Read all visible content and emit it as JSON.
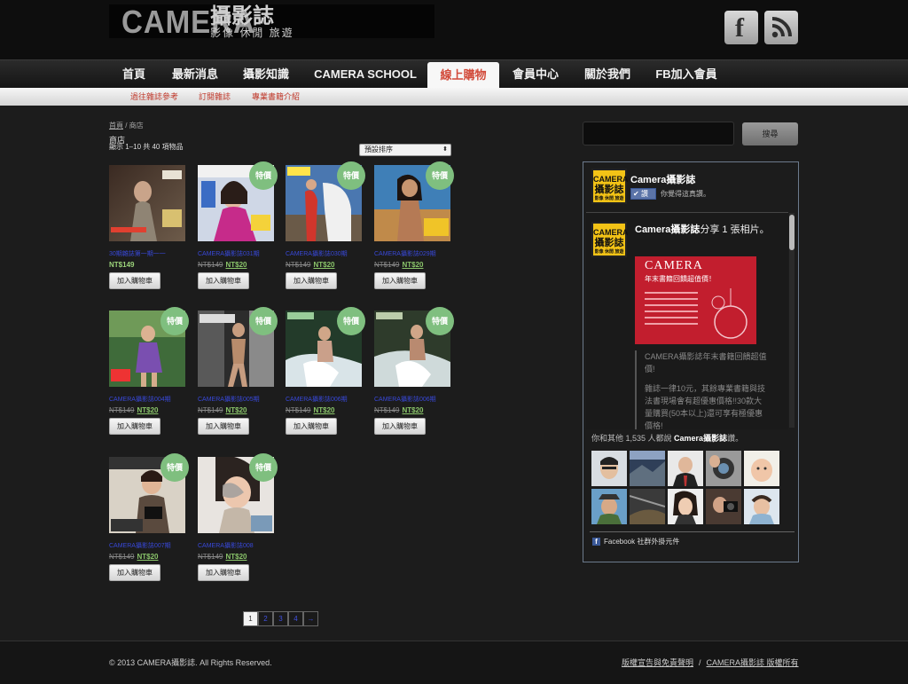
{
  "header": {
    "logo_latin": "CAMERA",
    "logo_cn": "攝影誌",
    "logo_tagline": "影像 休閒 旅遊",
    "facebook_glyph": "f"
  },
  "nav": {
    "items": [
      "首頁",
      "最新消息",
      "攝影知識",
      "CAMERA SCHOOL",
      "線上購物",
      "會員中心",
      "關於我們",
      "FB加入會員"
    ],
    "active_index": 4
  },
  "subnav": {
    "items": [
      "過往雜誌參考",
      "訂閱雜誌",
      "專業書籍介紹"
    ]
  },
  "breadcrumb": {
    "home": "首頁",
    "separator": " / ",
    "current": "商店"
  },
  "shop": {
    "title": "商店",
    "results": "顯示 1–10 共 40 項物品",
    "sort_label": "預設排序",
    "sort_arrow": "⬍",
    "sale_badge": "特價",
    "add_to_cart": "加入購物車"
  },
  "products": [
    {
      "name": "30期雜誌第一期一一",
      "old_price": "",
      "price": "NT$149",
      "sale": false
    },
    {
      "name": "CAMERA攝影誌031期",
      "old_price": "NT$149",
      "price": "NT$20",
      "sale": true
    },
    {
      "name": "CAMERA攝影誌030期",
      "old_price": "NT$149",
      "price": "NT$20",
      "sale": true
    },
    {
      "name": "CAMERA攝影誌029期",
      "old_price": "NT$149",
      "price": "NT$20",
      "sale": true
    },
    {
      "name": "CAMERA攝影誌004期",
      "old_price": "NT$149",
      "price": "NT$20",
      "sale": true
    },
    {
      "name": "CAMERA攝影誌005期",
      "old_price": "NT$149",
      "price": "NT$20",
      "sale": true
    },
    {
      "name": "CAMERA攝影誌006期",
      "old_price": "NT$149",
      "price": "NT$20",
      "sale": true
    },
    {
      "name": "CAMERA攝影誌006期",
      "old_price": "NT$149",
      "price": "NT$20",
      "sale": true
    },
    {
      "name": "CAMERA攝影誌007期",
      "old_price": "NT$149",
      "price": "NT$20",
      "sale": true
    },
    {
      "name": "CAMERA攝影誌008",
      "old_price": "NT$149",
      "price": "NT$20",
      "sale": true
    }
  ],
  "pagination": {
    "pages": [
      "1",
      "2",
      "3",
      "4",
      "→"
    ],
    "current": "1"
  },
  "search": {
    "button": "搜尋",
    "placeholder": ""
  },
  "facebook_box": {
    "page_name": "Camera攝影誌",
    "logo_line1": "CAMERA",
    "logo_line2": "攝影誌",
    "logo_line3": "影像 休閒 旅遊",
    "like_button": "讚",
    "like_text": "你覺得這真讚。",
    "post_author": "Camera攝影誌",
    "post_action": "分享 1 張相片。",
    "post_image_title": "CAMERA",
    "post_image_subtitle": "年末書籍回饋超值價！",
    "post_text_1": "CAMERA攝影誌年末書籍回饋超值價!",
    "post_text_2": "雜誌一律10元，其餘專業書籍與技法書現場會有超優惠價格!!30款大量購買(50本以上)還可享有極優惠價格!",
    "fans_count_text": "你和其他 1,535 人都說",
    "fans_page": "Camera攝影誌",
    "fans_suffix": "讚。",
    "plugin_label": "Facebook 社群外掛元件"
  },
  "footer": {
    "copyright": "© 2013 CAMERA攝影誌. All Rights Reserved.",
    "link_1": "版權宣告與免責聲明",
    "separator": "/",
    "link_2": "CAMERA攝影誌 版權所有"
  },
  "colors": {
    "accent_red": "#d24a3a",
    "sale_green": "#7fbf7f",
    "price_green": "#8ac56a",
    "link_blue": "#3848d8",
    "facebook_blue": "#3b5998",
    "logo_yellow": "#f3c316"
  },
  "icons": [
    "facebook-icon",
    "rss-icon",
    "like-thumb-icon",
    "facebook-small-icon"
  ]
}
